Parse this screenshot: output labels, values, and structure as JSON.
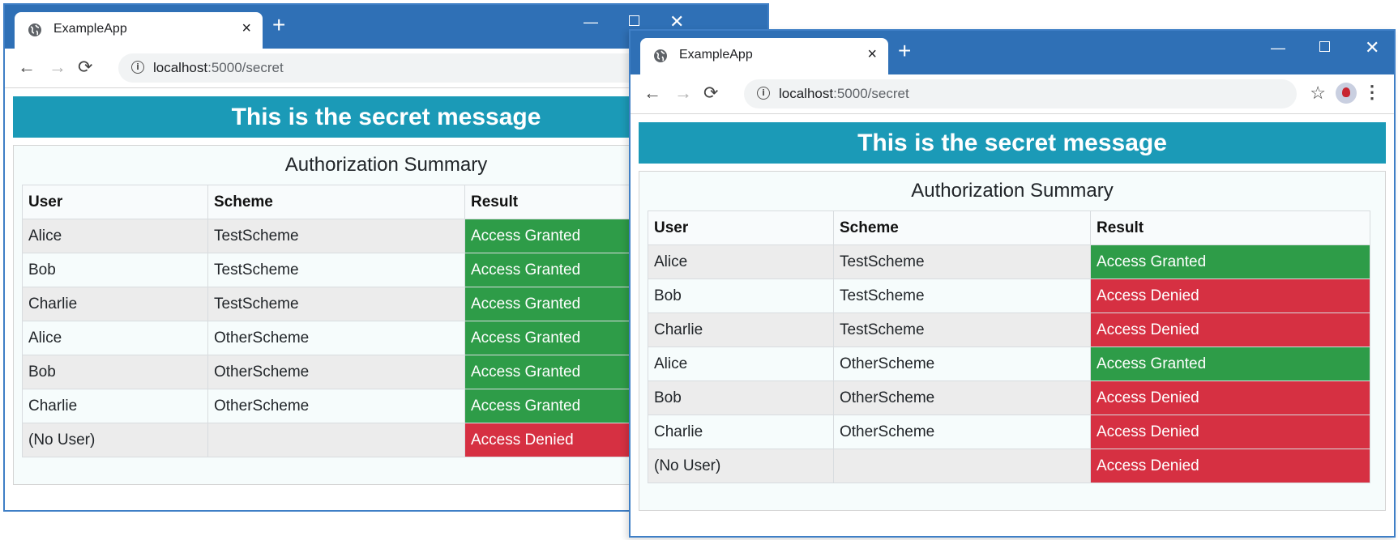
{
  "browser": {
    "tab_title": "ExampleApp",
    "tab_close": "×",
    "new_tab": "+",
    "url_host": "localhost",
    "url_path": ":5000/secret",
    "back": "←",
    "forward": "→",
    "reload": "⟳",
    "info": "i",
    "min": "—",
    "close": "✕",
    "star": "☆",
    "menu": "⋮"
  },
  "page": {
    "banner": "This is the secret message",
    "summary_title": "Authorization Summary",
    "columns": [
      "User",
      "Scheme",
      "Result"
    ]
  },
  "windows": [
    {
      "name": "window-left",
      "rows": [
        {
          "user": "Alice",
          "scheme": "TestScheme",
          "result": "Access Granted"
        },
        {
          "user": "Bob",
          "scheme": "TestScheme",
          "result": "Access Granted"
        },
        {
          "user": "Charlie",
          "scheme": "TestScheme",
          "result": "Access Granted"
        },
        {
          "user": "Alice",
          "scheme": "OtherScheme",
          "result": "Access Granted"
        },
        {
          "user": "Bob",
          "scheme": "OtherScheme",
          "result": "Access Granted"
        },
        {
          "user": "Charlie",
          "scheme": "OtherScheme",
          "result": "Access Granted"
        },
        {
          "user": "(No User)",
          "scheme": "",
          "result": "Access Denied"
        }
      ]
    },
    {
      "name": "window-right",
      "rows": [
        {
          "user": "Alice",
          "scheme": "TestScheme",
          "result": "Access Granted"
        },
        {
          "user": "Bob",
          "scheme": "TestScheme",
          "result": "Access Denied"
        },
        {
          "user": "Charlie",
          "scheme": "TestScheme",
          "result": "Access Denied"
        },
        {
          "user": "Alice",
          "scheme": "OtherScheme",
          "result": "Access Granted"
        },
        {
          "user": "Bob",
          "scheme": "OtherScheme",
          "result": "Access Denied"
        },
        {
          "user": "Charlie",
          "scheme": "OtherScheme",
          "result": "Access Denied"
        },
        {
          "user": "(No User)",
          "scheme": "",
          "result": "Access Denied"
        }
      ]
    }
  ],
  "colors": {
    "titlebar": "#2f70b6",
    "banner": "#1b9ab7",
    "granted": "#2e9c48",
    "denied": "#d63042"
  }
}
